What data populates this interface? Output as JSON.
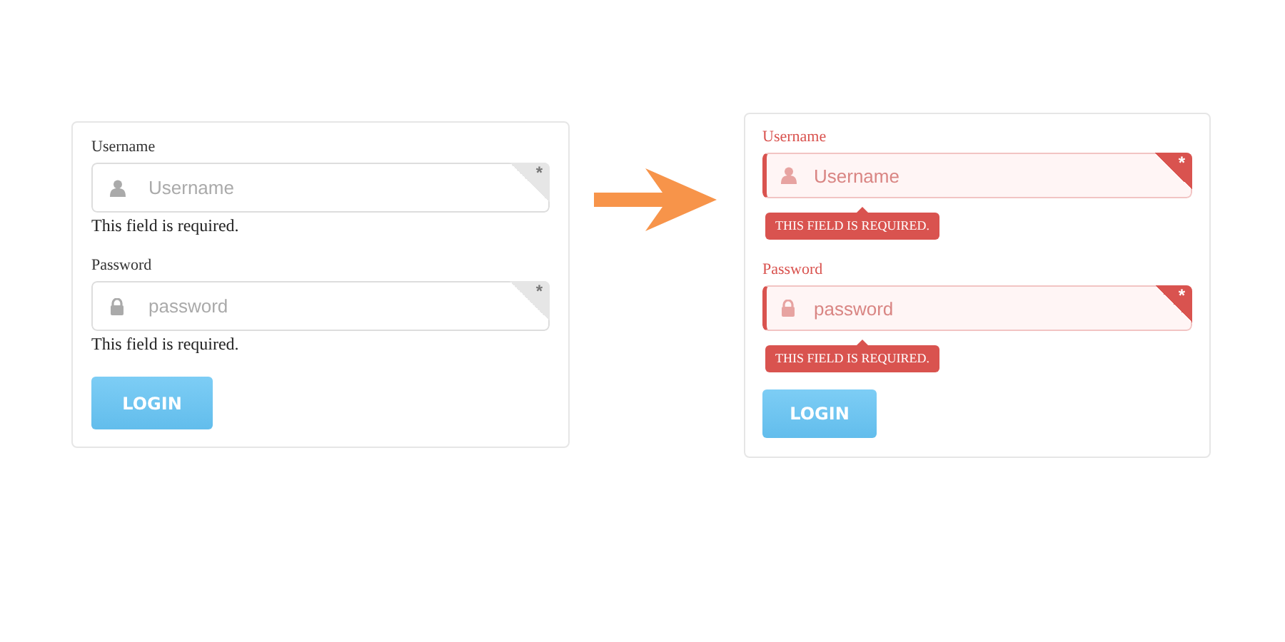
{
  "panels": [
    {
      "kind": "plain",
      "fields": [
        {
          "label": "Username",
          "kind": "user",
          "placeholder": "Username",
          "required_mark": "*",
          "error": "This field is required."
        },
        {
          "label": "Password",
          "kind": "lock",
          "placeholder": "password",
          "required_mark": "*",
          "error": "This field is required."
        }
      ],
      "button": "LOGIN"
    },
    {
      "kind": "styled",
      "fields": [
        {
          "label": "Username",
          "kind": "user",
          "placeholder": "Username",
          "required_mark": "*",
          "error": "THIS FIELD IS REQUIRED."
        },
        {
          "label": "Password",
          "kind": "lock",
          "placeholder": "password",
          "required_mark": "*",
          "error": "THIS FIELD IS REQUIRED."
        }
      ],
      "button": "LOGIN"
    }
  ]
}
